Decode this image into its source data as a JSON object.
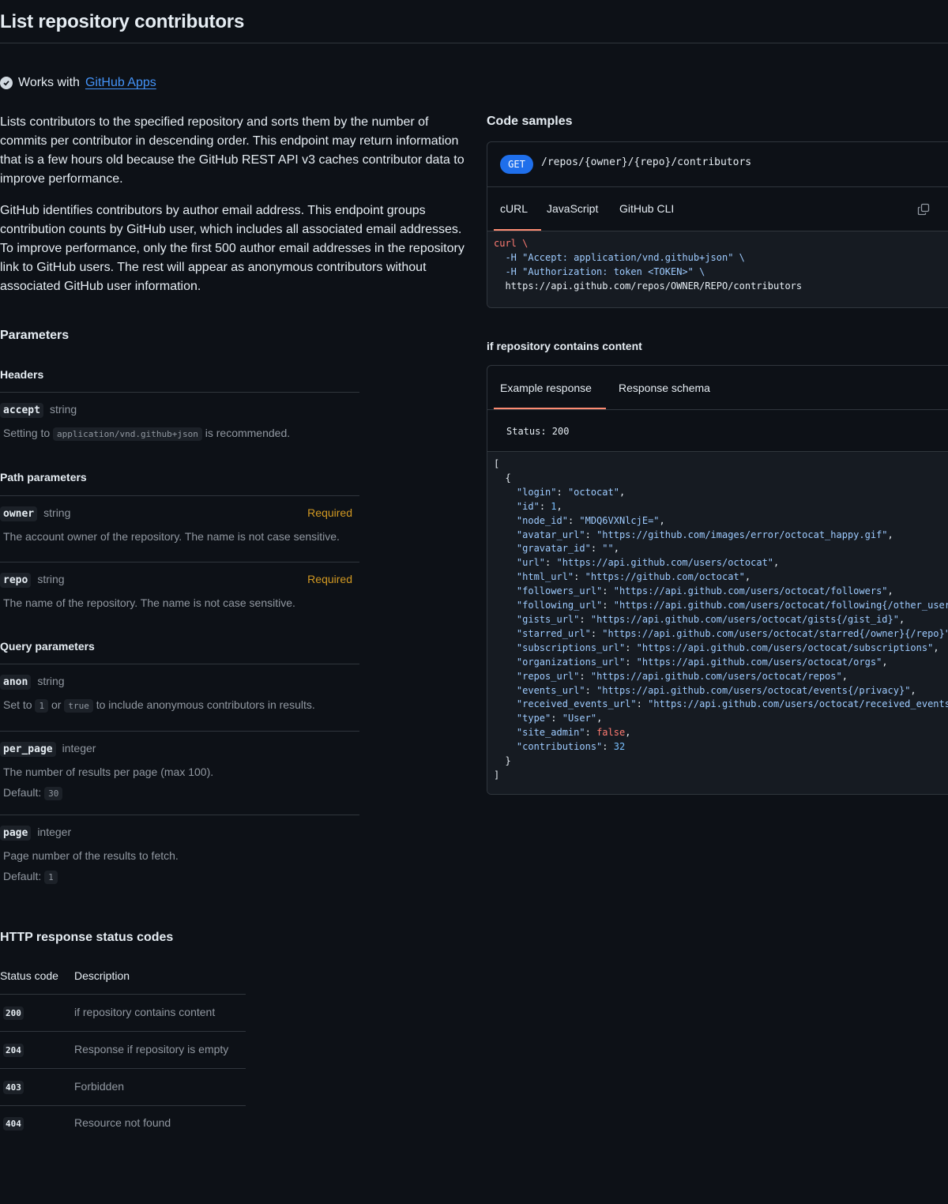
{
  "page": {
    "title": "List repository contributors",
    "works_with_prefix": "Works with",
    "works_with_link": "GitHub Apps",
    "description_1": "Lists contributors to the specified repository and sorts them by the number of commits per contributor in descending order. This endpoint may return information that is a few hours old because the GitHub REST API v3 caches contributor data to improve performance.",
    "description_2": "GitHub identifies contributors by author email address. This endpoint groups contribution counts by GitHub user, which includes all associated email addresses. To improve performance, only the first 500 author email addresses in the repository link to GitHub users. The rest will appear as anonymous contributors without associated GitHub user information."
  },
  "parameters": {
    "heading": "Parameters",
    "headers_heading": "Headers",
    "path_heading": "Path parameters",
    "query_heading": "Query parameters",
    "default_label": "Default:",
    "accept": {
      "name": "accept",
      "type": "string",
      "desc_prefix": "Setting to",
      "desc_code": "application/vnd.github+json",
      "desc_suffix": "is recommended."
    },
    "owner": {
      "name": "owner",
      "type": "string",
      "required": "Required",
      "desc": "The account owner of the repository. The name is not case sensitive."
    },
    "repo": {
      "name": "repo",
      "type": "string",
      "required": "Required",
      "desc": "The name of the repository. The name is not case sensitive."
    },
    "anon": {
      "name": "anon",
      "type": "string",
      "desc_a": "Set to",
      "code_1": "1",
      "desc_b": "or",
      "code_2": "true",
      "desc_c": "to include anonymous contributors in results."
    },
    "per_page": {
      "name": "per_page",
      "type": "integer",
      "desc": "The number of results per page (max 100).",
      "default": "30"
    },
    "page": {
      "name": "page",
      "type": "integer",
      "desc": "Page number of the results to fetch.",
      "default": "1"
    }
  },
  "status_codes": {
    "heading": "HTTP response status codes",
    "col_code": "Status code",
    "col_desc": "Description",
    "rows": [
      {
        "code": "200",
        "desc": "if repository contains content"
      },
      {
        "code": "204",
        "desc": "Response if repository is empty"
      },
      {
        "code": "403",
        "desc": "Forbidden"
      },
      {
        "code": "404",
        "desc": "Resource not found"
      }
    ]
  },
  "code_samples": {
    "heading": "Code samples",
    "method": "GET",
    "path": "/repos/{owner}/{repo}/contributors",
    "tabs": [
      "cURL",
      "JavaScript",
      "GitHub CLI"
    ],
    "active_tab": "cURL",
    "curl_lines": [
      "curl \\",
      "  -H \"Accept: application/vnd.github+json\" \\",
      "  -H \"Authorization: token <TOKEN>\" \\",
      "  https://api.github.com/repos/OWNER/REPO/contributors"
    ]
  },
  "response": {
    "heading": "if repository contains content",
    "tabs": [
      "Example response",
      "Response schema"
    ],
    "active_tab": "Example response",
    "status_label": "Status: 200",
    "json_fields": [
      {
        "key": "login",
        "value": "\"octocat\"",
        "kind": "string"
      },
      {
        "key": "id",
        "value": "1",
        "kind": "number"
      },
      {
        "key": "node_id",
        "value": "\"MDQ6VXNlcjE=\"",
        "kind": "string"
      },
      {
        "key": "avatar_url",
        "value": "\"https://github.com/images/error/octocat_happy.gif\"",
        "kind": "string"
      },
      {
        "key": "gravatar_id",
        "value": "\"\"",
        "kind": "string"
      },
      {
        "key": "url",
        "value": "\"https://api.github.com/users/octocat\"",
        "kind": "string"
      },
      {
        "key": "html_url",
        "value": "\"https://github.com/octocat\"",
        "kind": "string"
      },
      {
        "key": "followers_url",
        "value": "\"https://api.github.com/users/octocat/followers\"",
        "kind": "string"
      },
      {
        "key": "following_url",
        "value": "\"https://api.github.com/users/octocat/following{/other_user}\"",
        "kind": "string"
      },
      {
        "key": "gists_url",
        "value": "\"https://api.github.com/users/octocat/gists{/gist_id}\"",
        "kind": "string"
      },
      {
        "key": "starred_url",
        "value": "\"https://api.github.com/users/octocat/starred{/owner}{/repo}\"",
        "kind": "string"
      },
      {
        "key": "subscriptions_url",
        "value": "\"https://api.github.com/users/octocat/subscriptions\"",
        "kind": "string"
      },
      {
        "key": "organizations_url",
        "value": "\"https://api.github.com/users/octocat/orgs\"",
        "kind": "string"
      },
      {
        "key": "repos_url",
        "value": "\"https://api.github.com/users/octocat/repos\"",
        "kind": "string"
      },
      {
        "key": "events_url",
        "value": "\"https://api.github.com/users/octocat/events{/privacy}\"",
        "kind": "string"
      },
      {
        "key": "received_events_url",
        "value": "\"https://api.github.com/users/octocat/received_events\"",
        "kind": "string"
      },
      {
        "key": "type",
        "value": "\"User\"",
        "kind": "string"
      },
      {
        "key": "site_admin",
        "value": "false",
        "kind": "bool"
      },
      {
        "key": "contributions",
        "value": "32",
        "kind": "number"
      }
    ]
  },
  "colors": {
    "background": "#0d1117",
    "border": "#30363d",
    "link": "#4493f8",
    "required": "#d29922",
    "get_badge": "#1f6feb",
    "active_tab_underline": "#fd8c73"
  }
}
